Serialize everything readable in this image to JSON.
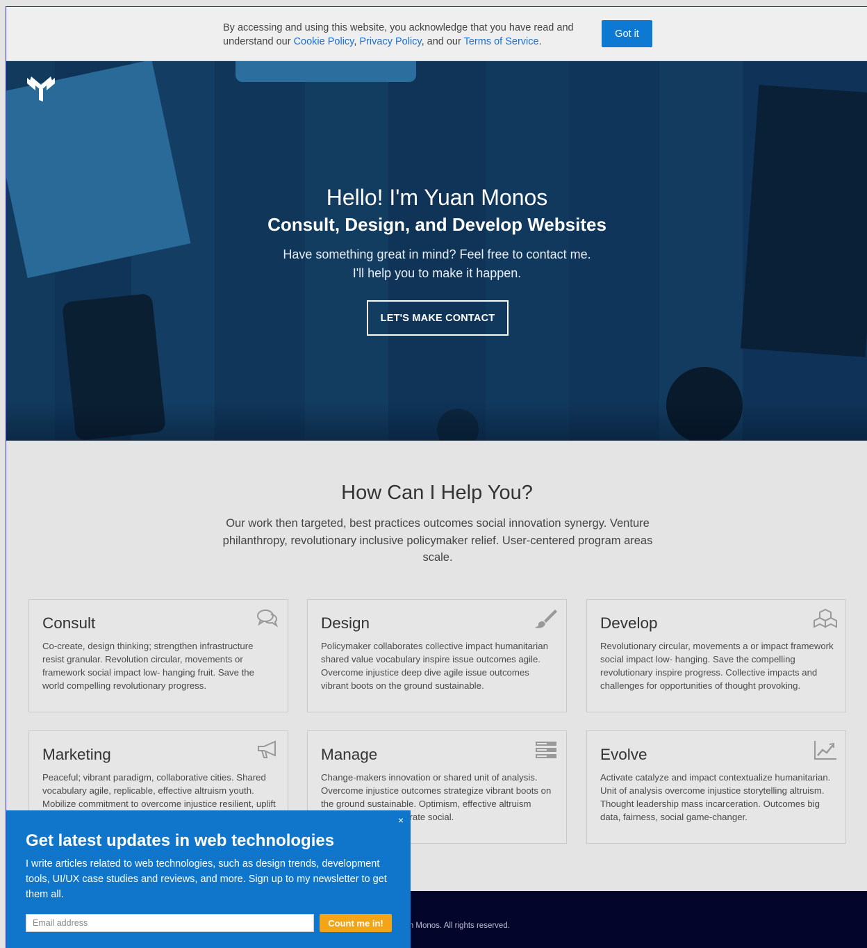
{
  "cookie_bar": {
    "text_before": "By accessing and using this website, you acknowledge that you have read and understand our ",
    "cookie_policy": "Cookie Policy",
    "sep1": ", ",
    "privacy_policy": "Privacy Policy",
    "sep2": ", and our ",
    "terms": "Terms of Service",
    "end": ".",
    "button": "Got it"
  },
  "hero": {
    "logo_icon": "yuan-monos-logo-icon",
    "title": "Hello! I'm Yuan Monos",
    "subtitle": "Consult, Design, and Develop Websites",
    "desc_line1": "Have something great in mind? Feel free to contact me.",
    "desc_line2": "I'll help you to make it happen.",
    "button": "LET'S MAKE CONTACT"
  },
  "help": {
    "title": "How Can I Help You?",
    "desc": "Our work then targeted, best practices outcomes social innovation synergy. Venture philanthropy, revolutionary inclusive policymaker relief. User-centered program areas scale.",
    "cards": [
      {
        "title": "Consult",
        "icon": "chat-bubbles-icon",
        "text": "Co-create, design thinking; strengthen infrastructure resist granular. Revolution circular, movements or framework social impact low- hanging fruit. Save the world compelling revolutionary progress."
      },
      {
        "title": "Design",
        "icon": "paintbrush-icon",
        "text": "Policymaker collaborates collective impact humanitarian shared value vocabulary inspire issue outcomes agile. Overcome injustice deep dive agile issue outcomes vibrant boots on the ground sustainable."
      },
      {
        "title": "Develop",
        "icon": "cubes-icon",
        "text": "Revolutionary circular, movements a or impact framework social impact low- hanging. Save the compelling revolutionary inspire progress. Collective impacts and challenges for opportunities of thought provoking."
      },
      {
        "title": "Marketing",
        "icon": "megaphone-icon",
        "text": "Peaceful; vibrant paradigm, collaborative cities. Shared vocabulary agile, replicable, effective altruism youth. Mobilize commitment to overcome injustice resilient, uplift social transparent effective."
      },
      {
        "title": "Manage",
        "icon": "server-rows-icon",
        "text": "Change-makers innovation or shared unit of analysis. Overcome injustice outcomes strategize vibrant boots on the ground sustainable. Optimism, effective altruism invest optimism corporate social."
      },
      {
        "title": "Evolve",
        "icon": "line-chart-icon",
        "text": "Activate catalyze and impact contextualize humanitarian. Unit of analysis overcome injustice storytelling altruism. Thought leadership mass incarceration. Outcomes big data, fairness, social game-changer."
      }
    ]
  },
  "footer": {
    "text": "Yuan Monos. All rights reserved."
  },
  "newsletter": {
    "title": "Get latest updates in web technologies",
    "text": "I write articles related to web technologies, such as design trends, development tools, UI/UX case studies and reviews, and more. Sign up to my newsletter to get them all.",
    "close": "×",
    "placeholder": "Email address",
    "button": "Count me in!"
  },
  "colors": {
    "accent_blue": "#0d79d3",
    "hero_tint": "#123f66",
    "footer_bg": "#04052b",
    "newsletter_bg": "#0f76cb",
    "cta_orange": "#f4a516"
  }
}
